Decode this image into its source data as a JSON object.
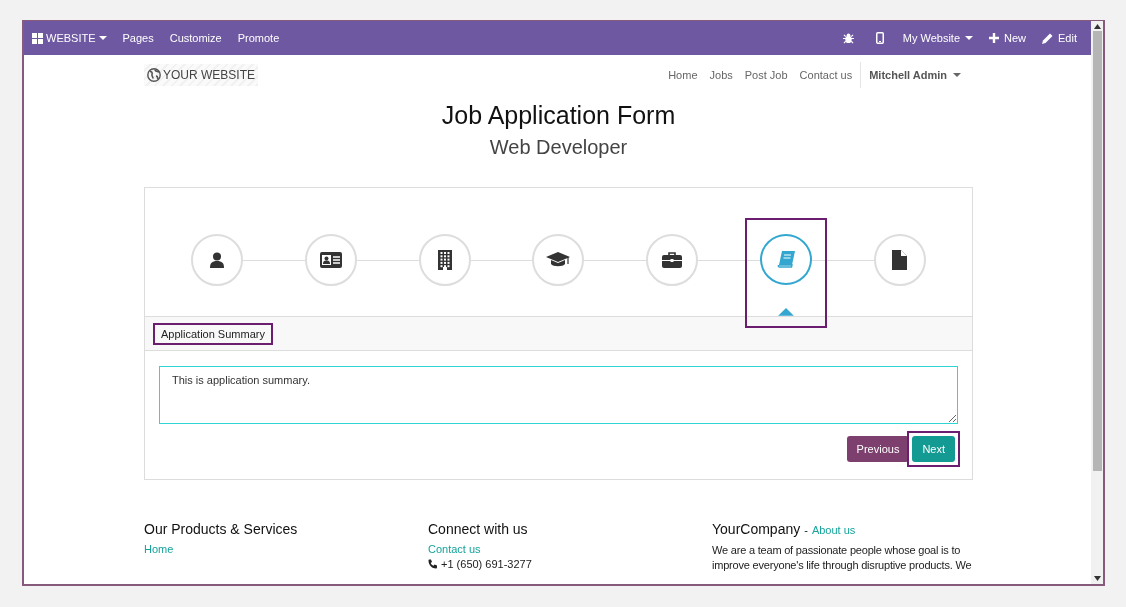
{
  "editor_bar": {
    "app_menu": "WEBSITE",
    "items": [
      "Pages",
      "Customize",
      "Promote"
    ],
    "website_menu": "My Website",
    "new_button": "New",
    "edit_button": "Edit"
  },
  "site_header": {
    "logo": "YOUR WEBSITE",
    "nav": [
      "Home",
      "Jobs",
      "Post Job",
      "Contact us"
    ],
    "user_menu": "Mitchell Admin"
  },
  "title": "Job Application Form",
  "subtitle": "Web Developer",
  "steps": [
    {
      "kind": "person",
      "selected": false
    },
    {
      "kind": "id-card",
      "selected": false
    },
    {
      "kind": "building",
      "selected": false
    },
    {
      "kind": "graduation-cap",
      "selected": false
    },
    {
      "kind": "briefcase",
      "selected": false
    },
    {
      "kind": "book",
      "selected": true
    },
    {
      "kind": "file",
      "selected": false
    }
  ],
  "section_title": "Application Summary",
  "summary_field": {
    "value": "This is application summary."
  },
  "buttons": {
    "previous": "Previous",
    "next": "Next"
  },
  "footer": {
    "products": {
      "heading": "Our Products & Services",
      "links": [
        "Home"
      ]
    },
    "connect": {
      "heading": "Connect with us",
      "link": "Contact us",
      "phone": "+1 (650) 691-3277"
    },
    "company": {
      "name": "YourCompany",
      "separator": "-",
      "link": "About us",
      "text": "We are a team of passionate people whose goal is to improve everyone's life through disruptive products. We"
    }
  }
}
